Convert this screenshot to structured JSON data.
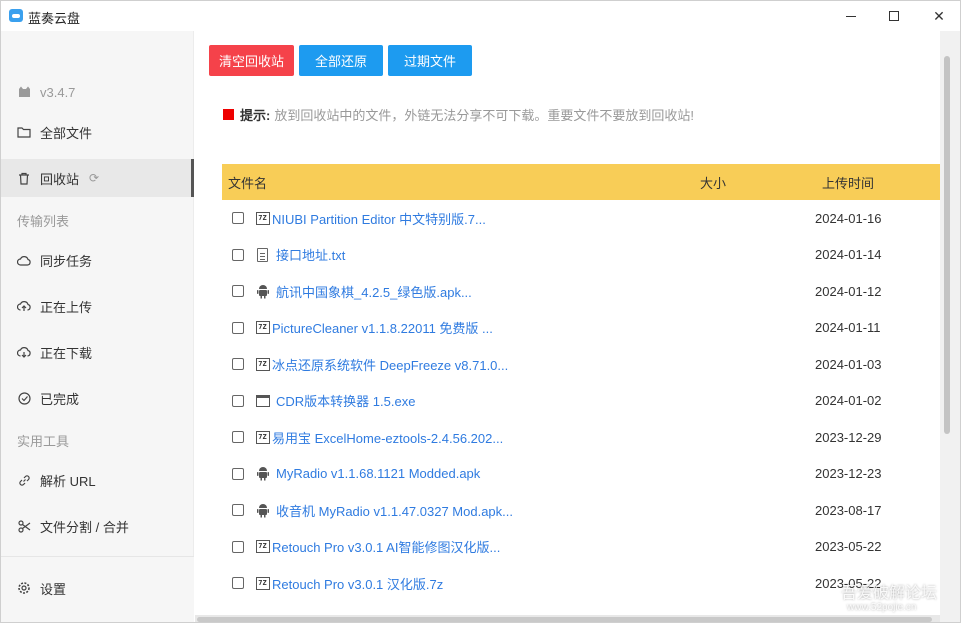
{
  "window": {
    "title": "蓝奏云盘",
    "minimize_icon": "minimize-icon",
    "maximize_icon": "maximize-icon",
    "close_icon": "close-icon"
  },
  "sidebar": {
    "version": "v3.4.7",
    "items": [
      {
        "label": "全部文件",
        "icon": "folder-icon"
      },
      {
        "label": "回收站",
        "icon": "trash-icon"
      }
    ],
    "section_transfer": "传输列表",
    "transfer_items": [
      {
        "label": "同步任务",
        "icon": "cloud-sync-icon"
      },
      {
        "label": "正在上传",
        "icon": "cloud-upload-icon"
      },
      {
        "label": "正在下载",
        "icon": "cloud-download-icon"
      },
      {
        "label": "已完成",
        "icon": "check-circle-icon"
      }
    ],
    "section_tools": "实用工具",
    "tool_items": [
      {
        "label": "解析 URL",
        "icon": "link-icon"
      },
      {
        "label": "文件分割 / 合并",
        "icon": "scissors-icon"
      }
    ],
    "settings_label": "设置"
  },
  "toolbar": {
    "clear_label": "清空回收站",
    "restore_all_label": "全部还原",
    "expired_label": "过期文件"
  },
  "tip": {
    "label": "提示:",
    "text": "放到回收站中的文件，外链无法分享不可下载。重要文件不要放到回收站!"
  },
  "table": {
    "columns": {
      "name": "文件名",
      "size": "大小",
      "time": "上传时间"
    },
    "rows": [
      {
        "name": "NIUBI Partition Editor 中文特别版.7...",
        "date": "2024-01-16",
        "icon": "zip"
      },
      {
        "name": "接口地址.txt",
        "date": "2024-01-14",
        "icon": "txt"
      },
      {
        "name": "航讯中国象棋_4.2.5_绿色版.apk...",
        "date": "2024-01-12",
        "icon": "apk"
      },
      {
        "name": "PictureCleaner v1.1.8.22011 免费版 ...",
        "date": "2024-01-11",
        "icon": "zip"
      },
      {
        "name": "冰点还原系统软件 DeepFreeze v8.71.0...",
        "date": "2024-01-03",
        "icon": "zip"
      },
      {
        "name": "CDR版本转换器 1.5.exe",
        "date": "2024-01-02",
        "icon": "exe"
      },
      {
        "name": "易用宝 ExcelHome-eztools-2.4.56.202...",
        "date": "2023-12-29",
        "icon": "zip"
      },
      {
        "name": "MyRadio v1.1.68.1121 Modded.apk",
        "date": "2023-12-23",
        "icon": "apk"
      },
      {
        "name": "收音机 MyRadio v1.1.47.0327 Mod.apk...",
        "date": "2023-08-17",
        "icon": "apk"
      },
      {
        "name": "Retouch Pro v3.0.1 AI智能修图汉化版...",
        "date": "2023-05-22",
        "icon": "zip"
      },
      {
        "name": "Retouch Pro v3.0.1 汉化版.7z",
        "date": "2023-05-22",
        "icon": "zip"
      }
    ]
  },
  "watermark": {
    "text": "吾爱破解论坛",
    "url": "www.52pojie.cn"
  }
}
